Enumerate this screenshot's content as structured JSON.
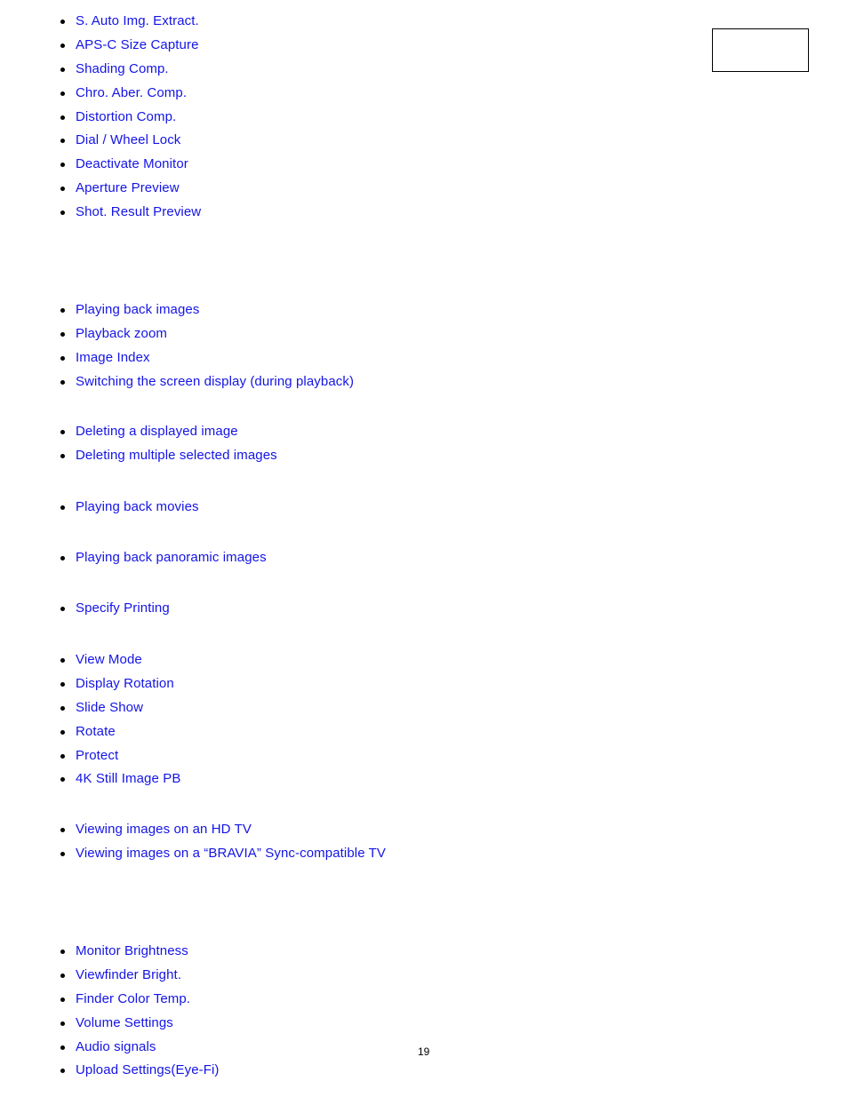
{
  "groups": [
    {
      "items": [
        "S. Auto Img. Extract.",
        "APS-C Size Capture",
        "Shading Comp.",
        "Chro. Aber. Comp.",
        "Distortion Comp.",
        "Dial / Wheel Lock",
        "Deactivate Monitor",
        "Aperture Preview",
        "Shot. Result Preview"
      ]
    },
    {
      "items": [
        "Playing back images",
        "Playback zoom",
        "Image Index",
        "Switching the screen display (during playback)"
      ]
    },
    {
      "items": [
        "Deleting a displayed image",
        "Deleting multiple selected images"
      ]
    },
    {
      "items": [
        "Playing back movies"
      ]
    },
    {
      "items": [
        "Playing back panoramic images"
      ]
    },
    {
      "items": [
        "Specify Printing"
      ]
    },
    {
      "items": [
        "View Mode",
        "Display Rotation",
        "Slide Show",
        "Rotate",
        "Protect",
        "4K Still Image PB"
      ]
    },
    {
      "items": [
        "Viewing images on an HD TV",
        "Viewing images on a “BRAVIA” Sync-compatible TV"
      ]
    },
    {
      "items": [
        "Monitor Brightness",
        "Viewfinder Bright.",
        "Finder Color Temp.",
        "Volume Settings",
        "Audio signals",
        "Upload Settings(Eye-Fi)"
      ]
    }
  ],
  "page_number": "19",
  "colors": {
    "link": "#1414e6",
    "text": "#000000"
  }
}
